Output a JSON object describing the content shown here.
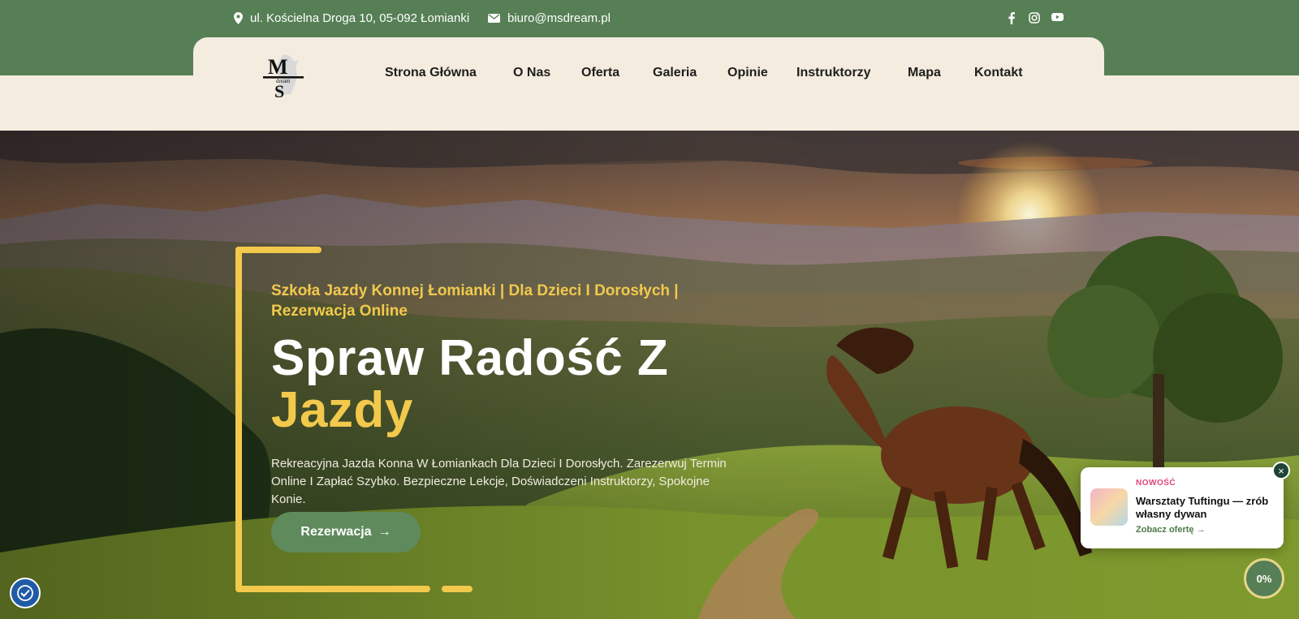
{
  "topbar": {
    "address": "ul. Kościelna Droga 10, 05-092 Łomianki",
    "email": "biuro@msdream.pl",
    "social": [
      "facebook-icon",
      "instagram-icon",
      "youtube-icon"
    ]
  },
  "nav": {
    "logo_text_top": "M",
    "logo_text_mid": "dream",
    "logo_text_bottom": "S",
    "items": [
      "Strona Główna",
      "O Nas",
      "Oferta",
      "Galeria",
      "Opinie",
      "Instruktorzy",
      "Mapa",
      "Kontakt"
    ]
  },
  "hero": {
    "subtitle": "Szkoła Jazdy Konnej Łomianki | Dla Dzieci I Dorosłych | Rezerwacja Online",
    "title_line1": "Spraw Radość Z",
    "title_line2": "Jazdy",
    "description": "Rekreacyjna Jazda Konna W Łomiankach Dla Dzieci I Dorosłych. Zarezerwuj Termin Online I Zapłać Szybko. Bezpieczne Lekcje, Doświadczeni Instruktorzy, Spokojne Konie.",
    "cta_label": "Rezerwacja",
    "cta_arrow": "→"
  },
  "promo": {
    "tag": "NOWOŚĆ",
    "title": "Warsztaty Tuftingu — zrób własny dywan",
    "link": "Zobacz ofertę →",
    "close": "×"
  },
  "progress": {
    "label": "0%",
    "value": 0
  },
  "colors": {
    "green": "#567f55",
    "cream": "#f4ecdf",
    "gold": "#f2c94c"
  }
}
